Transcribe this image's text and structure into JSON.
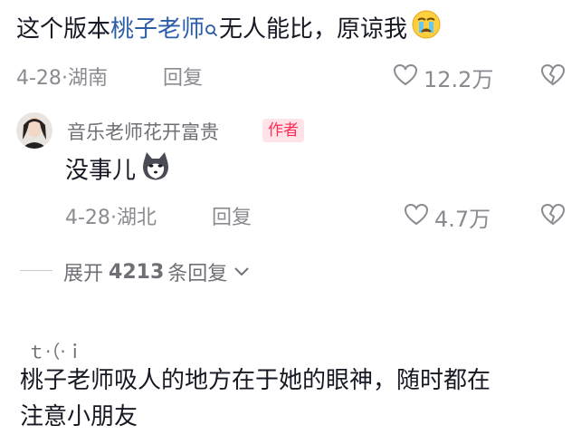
{
  "comment": {
    "prefix": "这个版本",
    "mention": "桃子老师",
    "suffix": "无人能比，原谅我",
    "date": "4-28",
    "location": "湖南",
    "reply_label": "回复",
    "likes": "12.2万",
    "emoji_name": "crying-face-icon"
  },
  "reply": {
    "author": "音乐老师花开富贵",
    "author_tag": "作者",
    "text": "没事儿",
    "emoji_name": "husky-dog-icon",
    "date": "4-28",
    "location": "湖北",
    "reply_label": "回复",
    "likes": "4.7万"
  },
  "expand": {
    "prefix": "展开",
    "count": "4213",
    "suffix": "条回复"
  },
  "next_comment": {
    "user_partial": "ｔ·（·ｉ",
    "text_line1": "桃子老师吸人的地方在于她的眼神，随时都在",
    "text_line2": "注意小朋友"
  },
  "colors": {
    "mention": "#2c5ea8",
    "secondary_text": "#8a8b91",
    "author_tag_text": "#fe2c55",
    "author_tag_bg": "#ffe3e9"
  }
}
